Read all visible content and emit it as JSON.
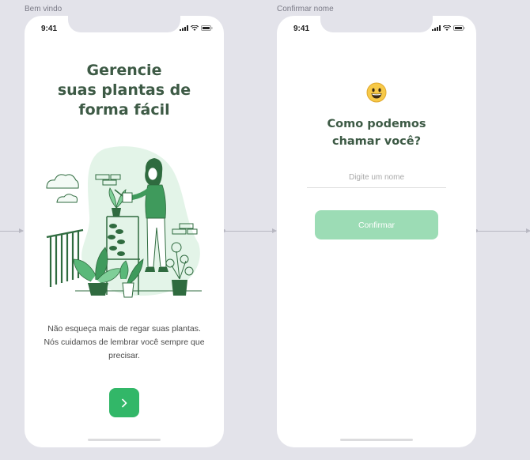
{
  "frames": {
    "welcome_label": "Bem vindo",
    "name_label": "Confirmar nome"
  },
  "status_bar": {
    "time": "9:41",
    "icons": [
      "signal-icon",
      "wifi-icon",
      "battery-icon"
    ]
  },
  "welcome": {
    "title": "Gerencie\nsuas plantas de\nforma fácil",
    "description": "Não esqueça mais de regar suas plantas. Nós cuidamos de lembrar você sempre que precisar.",
    "next_icon": "chevron-right-icon",
    "illustration": "woman-watering-plants-illustration"
  },
  "confirm_name": {
    "emoji": "grinning-face-icon",
    "title": "Como podemos\nchamar você?",
    "input_placeholder": "Digite um nome",
    "input_value": "",
    "button_label": "Confirmar"
  },
  "colors": {
    "background": "#e3e3ea",
    "heading": "#3d5a45",
    "primary": "#32b768",
    "primary_disabled": "#9cdcb5",
    "illustration": "#2f6b3f"
  }
}
